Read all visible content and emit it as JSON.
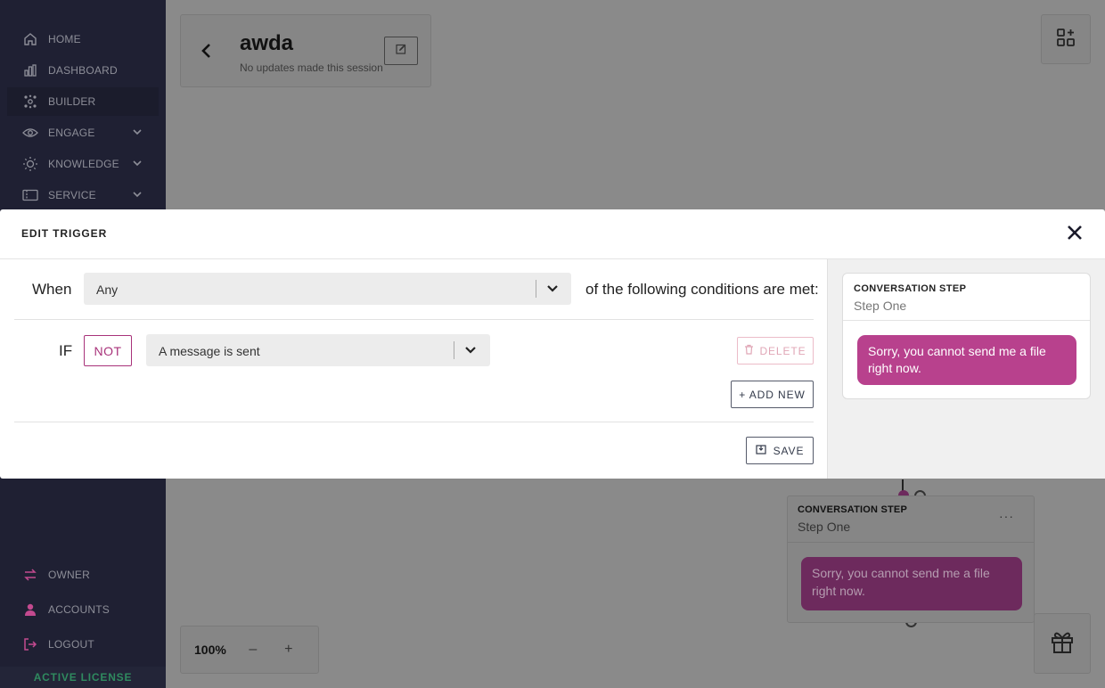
{
  "sidebar": {
    "items": [
      {
        "label": "HOME"
      },
      {
        "label": "DASHBOARD"
      },
      {
        "label": "BUILDER"
      },
      {
        "label": "ENGAGE"
      },
      {
        "label": "KNOWLEDGE"
      },
      {
        "label": "SERVICE"
      }
    ],
    "bottom_items": [
      {
        "label": "OWNER"
      },
      {
        "label": "ACCOUNTS"
      },
      {
        "label": "LOGOUT"
      }
    ],
    "license_label": "ACTIVE LICENSE"
  },
  "flow": {
    "name": "awda",
    "status": "No updates made this session"
  },
  "zoom": {
    "value": "100%",
    "minus": "–",
    "plus": "+"
  },
  "canvas_step": {
    "type_label": "CONVERSATION STEP",
    "name": "Step One",
    "message": "Sorry, you cannot send me a file right now.",
    "menu": "···"
  },
  "modal": {
    "title": "EDIT TRIGGER",
    "when_label": "When",
    "match_select_value": "Any",
    "conditions_text": "of the following conditions are met:",
    "if_label": "IF",
    "not_label": "NOT",
    "condition_select_value": "A message is sent",
    "delete_label": "DELETE",
    "add_new_label": "+ ADD NEW",
    "save_label": "SAVE"
  },
  "preview": {
    "type_label": "CONVERSATION STEP",
    "name": "Step One",
    "message": "Sorry, you cannot send me a file right now."
  },
  "colors": {
    "sidebar_bg": "#1f2033",
    "accent_magenta": "#b8418d",
    "license_green": "#2f8a5f"
  }
}
